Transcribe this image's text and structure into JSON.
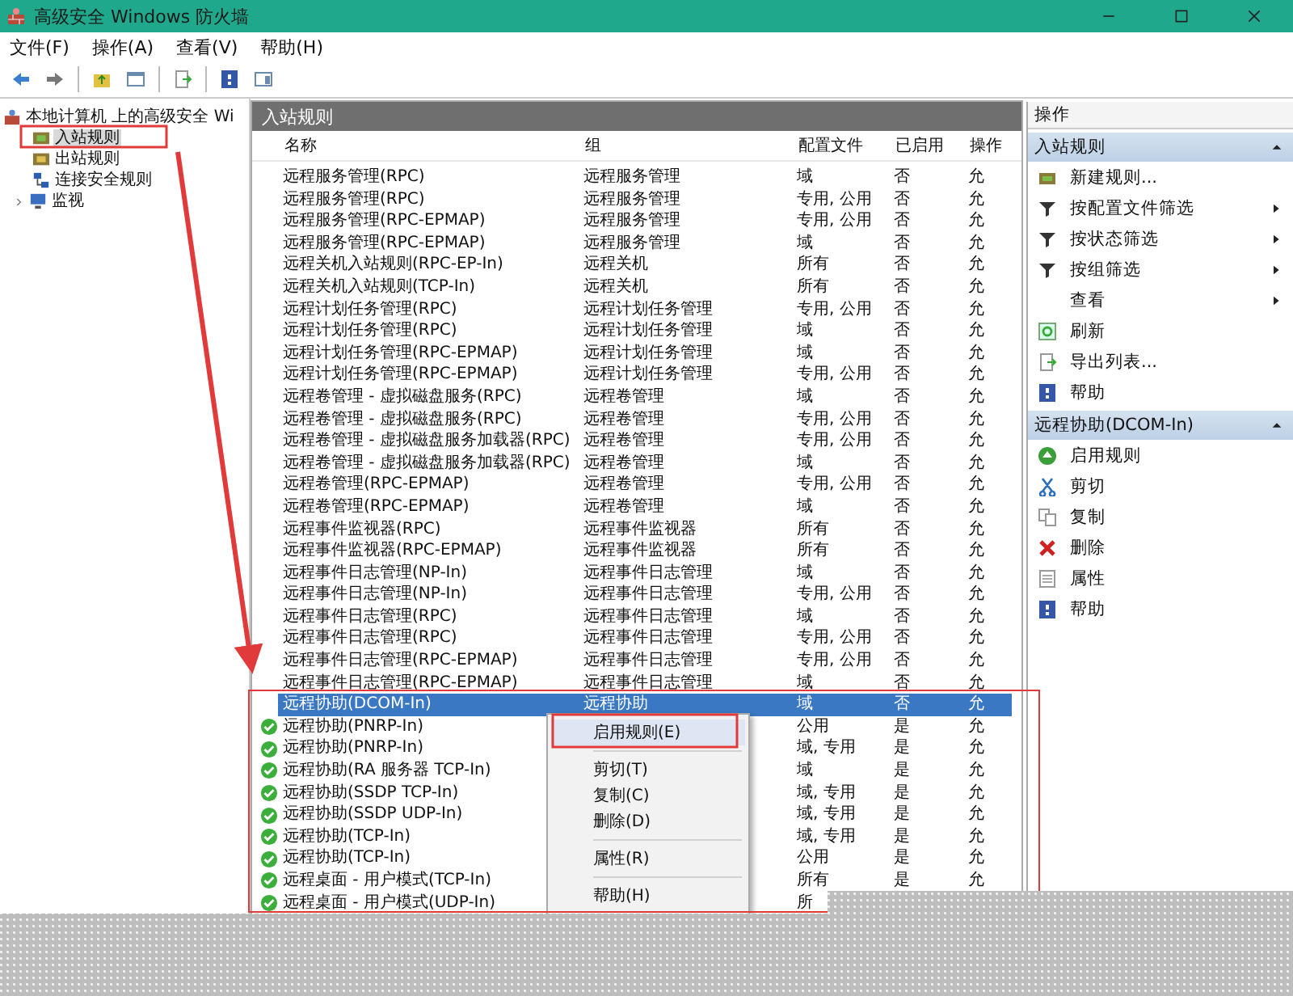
{
  "window": {
    "title": "高级安全 Windows 防火墙"
  },
  "menu": [
    "文件(F)",
    "操作(A)",
    "查看(V)",
    "帮助(H)"
  ],
  "tree": {
    "root": "本地计算机 上的高级安全 Wi",
    "children": [
      {
        "label": "入站规则",
        "kind": "inbound",
        "selected": true
      },
      {
        "label": "出站规则",
        "kind": "outbound",
        "selected": false
      },
      {
        "label": "连接安全规则",
        "kind": "security",
        "selected": false
      },
      {
        "label": "监视",
        "kind": "monitor",
        "selected": false,
        "expanded": false
      }
    ]
  },
  "rules": {
    "title": "入站规则",
    "columns": [
      "名称",
      "组",
      "配置文件",
      "已启用",
      "操作"
    ],
    "rows": [
      {
        "name": "远程服务管理(RPC)",
        "group": "远程服务管理",
        "profile": "域",
        "enabled": "否",
        "action": "允",
        "allowed": false,
        "selected": false
      },
      {
        "name": "远程服务管理(RPC)",
        "group": "远程服务管理",
        "profile": "专用, 公用",
        "enabled": "否",
        "action": "允",
        "allowed": false,
        "selected": false
      },
      {
        "name": "远程服务管理(RPC-EPMAP)",
        "group": "远程服务管理",
        "profile": "专用, 公用",
        "enabled": "否",
        "action": "允",
        "allowed": false,
        "selected": false
      },
      {
        "name": "远程服务管理(RPC-EPMAP)",
        "group": "远程服务管理",
        "profile": "域",
        "enabled": "否",
        "action": "允",
        "allowed": false,
        "selected": false
      },
      {
        "name": "远程关机入站规则(RPC-EP-In)",
        "group": "远程关机",
        "profile": "所有",
        "enabled": "否",
        "action": "允",
        "allowed": false,
        "selected": false
      },
      {
        "name": "远程关机入站规则(TCP-In)",
        "group": "远程关机",
        "profile": "所有",
        "enabled": "否",
        "action": "允",
        "allowed": false,
        "selected": false
      },
      {
        "name": "远程计划任务管理(RPC)",
        "group": "远程计划任务管理",
        "profile": "专用, 公用",
        "enabled": "否",
        "action": "允",
        "allowed": false,
        "selected": false
      },
      {
        "name": "远程计划任务管理(RPC)",
        "group": "远程计划任务管理",
        "profile": "域",
        "enabled": "否",
        "action": "允",
        "allowed": false,
        "selected": false
      },
      {
        "name": "远程计划任务管理(RPC-EPMAP)",
        "group": "远程计划任务管理",
        "profile": "域",
        "enabled": "否",
        "action": "允",
        "allowed": false,
        "selected": false
      },
      {
        "name": "远程计划任务管理(RPC-EPMAP)",
        "group": "远程计划任务管理",
        "profile": "专用, 公用",
        "enabled": "否",
        "action": "允",
        "allowed": false,
        "selected": false
      },
      {
        "name": "远程卷管理 - 虚拟磁盘服务(RPC)",
        "group": "远程卷管理",
        "profile": "域",
        "enabled": "否",
        "action": "允",
        "allowed": false,
        "selected": false
      },
      {
        "name": "远程卷管理 - 虚拟磁盘服务(RPC)",
        "group": "远程卷管理",
        "profile": "专用, 公用",
        "enabled": "否",
        "action": "允",
        "allowed": false,
        "selected": false
      },
      {
        "name": "远程卷管理 - 虚拟磁盘服务加载器(RPC)",
        "group": "远程卷管理",
        "profile": "专用, 公用",
        "enabled": "否",
        "action": "允",
        "allowed": false,
        "selected": false
      },
      {
        "name": "远程卷管理 - 虚拟磁盘服务加载器(RPC)",
        "group": "远程卷管理",
        "profile": "域",
        "enabled": "否",
        "action": "允",
        "allowed": false,
        "selected": false
      },
      {
        "name": "远程卷管理(RPC-EPMAP)",
        "group": "远程卷管理",
        "profile": "专用, 公用",
        "enabled": "否",
        "action": "允",
        "allowed": false,
        "selected": false
      },
      {
        "name": "远程卷管理(RPC-EPMAP)",
        "group": "远程卷管理",
        "profile": "域",
        "enabled": "否",
        "action": "允",
        "allowed": false,
        "selected": false
      },
      {
        "name": "远程事件监视器(RPC)",
        "group": "远程事件监视器",
        "profile": "所有",
        "enabled": "否",
        "action": "允",
        "allowed": false,
        "selected": false
      },
      {
        "name": "远程事件监视器(RPC-EPMAP)",
        "group": "远程事件监视器",
        "profile": "所有",
        "enabled": "否",
        "action": "允",
        "allowed": false,
        "selected": false
      },
      {
        "name": "远程事件日志管理(NP-In)",
        "group": "远程事件日志管理",
        "profile": "域",
        "enabled": "否",
        "action": "允",
        "allowed": false,
        "selected": false
      },
      {
        "name": "远程事件日志管理(NP-In)",
        "group": "远程事件日志管理",
        "profile": "专用, 公用",
        "enabled": "否",
        "action": "允",
        "allowed": false,
        "selected": false
      },
      {
        "name": "远程事件日志管理(RPC)",
        "group": "远程事件日志管理",
        "profile": "域",
        "enabled": "否",
        "action": "允",
        "allowed": false,
        "selected": false
      },
      {
        "name": "远程事件日志管理(RPC)",
        "group": "远程事件日志管理",
        "profile": "专用, 公用",
        "enabled": "否",
        "action": "允",
        "allowed": false,
        "selected": false
      },
      {
        "name": "远程事件日志管理(RPC-EPMAP)",
        "group": "远程事件日志管理",
        "profile": "专用, 公用",
        "enabled": "否",
        "action": "允",
        "allowed": false,
        "selected": false
      },
      {
        "name": "远程事件日志管理(RPC-EPMAP)",
        "group": "远程事件日志管理",
        "profile": "域",
        "enabled": "否",
        "action": "允",
        "allowed": false,
        "selected": false
      },
      {
        "name": "远程协助(DCOM-In)",
        "group": "远程协助",
        "profile": "域",
        "enabled": "否",
        "action": "允",
        "allowed": false,
        "selected": true
      },
      {
        "name": "远程协助(PNRP-In)",
        "profile": "公用",
        "enabled": "是",
        "action": "允",
        "allowed": true,
        "selected": false
      },
      {
        "name": "远程协助(PNRP-In)",
        "profile": "域, 专用",
        "enabled": "是",
        "action": "允",
        "allowed": true,
        "selected": false
      },
      {
        "name": "远程协助(RA 服务器 TCP-In)",
        "profile": "域",
        "enabled": "是",
        "action": "允",
        "allowed": true,
        "selected": false
      },
      {
        "name": "远程协助(SSDP TCP-In)",
        "profile": "域, 专用",
        "enabled": "是",
        "action": "允",
        "allowed": true,
        "selected": false
      },
      {
        "name": "远程协助(SSDP UDP-In)",
        "profile": "域, 专用",
        "enabled": "是",
        "action": "允",
        "allowed": true,
        "selected": false
      },
      {
        "name": "远程协助(TCP-In)",
        "profile": "域, 专用",
        "enabled": "是",
        "action": "允",
        "allowed": true,
        "selected": false
      },
      {
        "name": "远程协助(TCP-In)",
        "profile": "公用",
        "enabled": "是",
        "action": "允",
        "allowed": true,
        "selected": false
      },
      {
        "name": "远程桌面 - 用户模式(TCP-In)",
        "profile": "所有",
        "enabled": "是",
        "action": "允",
        "allowed": true,
        "selected": false
      },
      {
        "name": "远程桌面 - 用户模式(UDP-In)",
        "profile": "所",
        "allowed": true,
        "selected": false
      }
    ]
  },
  "context_menu": [
    {
      "kind": "item",
      "label": "启用规则(E)",
      "highlighted": true
    },
    {
      "kind": "separator"
    },
    {
      "kind": "item",
      "label": "剪切(T)",
      "highlighted": false
    },
    {
      "kind": "item",
      "label": "复制(C)",
      "highlighted": false
    },
    {
      "kind": "item",
      "label": "删除(D)",
      "highlighted": false
    },
    {
      "kind": "separator"
    },
    {
      "kind": "item",
      "label": "属性(R)",
      "highlighted": false
    },
    {
      "kind": "separator"
    },
    {
      "kind": "item",
      "label": "帮助(H)",
      "highlighted": false
    }
  ],
  "actions": {
    "title": "操作",
    "sections": [
      {
        "title": "入站规则",
        "items": [
          {
            "label": "新建规则...",
            "kind": "rule",
            "submenu": false
          },
          {
            "label": "按配置文件筛选",
            "kind": "filter",
            "submenu": true
          },
          {
            "label": "按状态筛选",
            "kind": "filter",
            "submenu": true
          },
          {
            "label": "按组筛选",
            "kind": "filter",
            "submenu": true
          },
          {
            "label": "查看",
            "kind": "view",
            "submenu": true
          },
          {
            "label": "刷新",
            "kind": "refresh",
            "submenu": false
          },
          {
            "label": "导出列表...",
            "kind": "export",
            "submenu": false
          },
          {
            "label": "帮助",
            "kind": "help",
            "submenu": false
          }
        ]
      },
      {
        "title": "远程协助(DCOM-In)",
        "items": [
          {
            "label": "启用规则",
            "kind": "enable",
            "submenu": false
          },
          {
            "label": "剪切",
            "kind": "cut",
            "submenu": false
          },
          {
            "label": "复制",
            "kind": "copy",
            "submenu": false
          },
          {
            "label": "删除",
            "kind": "delete",
            "submenu": false
          },
          {
            "label": "属性",
            "kind": "properties",
            "submenu": false
          },
          {
            "label": "帮助",
            "kind": "help",
            "submenu": false
          }
        ]
      }
    ]
  }
}
